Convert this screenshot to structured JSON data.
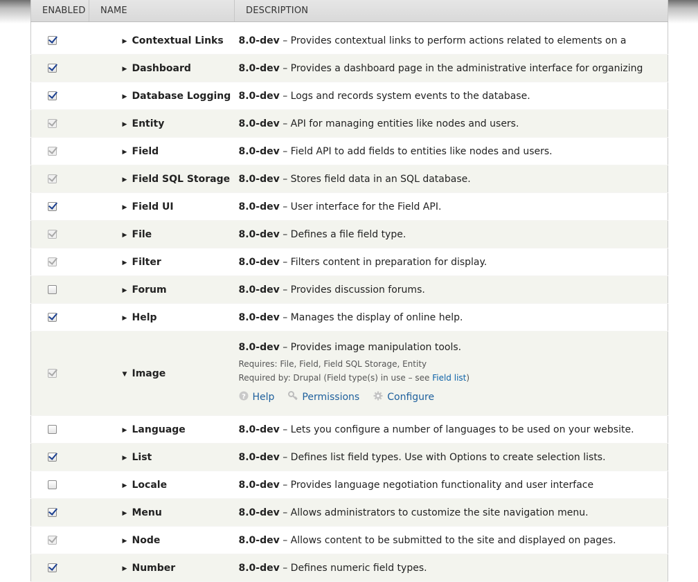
{
  "header": {
    "enabled": "ENABLED",
    "name": "NAME",
    "description": "DESCRIPTION"
  },
  "modules": [
    {
      "name": "Contextual Links",
      "version": "8.0-dev",
      "description": "– Provides contextual links to perform actions related to elements on a",
      "checked": true,
      "disabled": false
    },
    {
      "name": "Dashboard",
      "version": "8.0-dev",
      "description": "– Provides a dashboard page in the administrative interface for organizing",
      "checked": true,
      "disabled": false
    },
    {
      "name": "Database Logging",
      "version": "8.0-dev",
      "description": "– Logs and records system events to the database.",
      "checked": true,
      "disabled": false
    },
    {
      "name": "Entity",
      "version": "8.0-dev",
      "description": "– API for managing entities like nodes and users.",
      "checked": true,
      "disabled": true
    },
    {
      "name": "Field",
      "version": "8.0-dev",
      "description": "– Field API to add fields to entities like nodes and users.",
      "checked": true,
      "disabled": true
    },
    {
      "name": "Field SQL Storage",
      "version": "8.0-dev",
      "description": "– Stores field data in an SQL database.",
      "checked": true,
      "disabled": true
    },
    {
      "name": "Field UI",
      "version": "8.0-dev",
      "description": "– User interface for the Field API.",
      "checked": true,
      "disabled": false
    },
    {
      "name": "File",
      "version": "8.0-dev",
      "description": "– Defines a file field type.",
      "checked": true,
      "disabled": true
    },
    {
      "name": "Filter",
      "version": "8.0-dev",
      "description": "– Filters content in preparation for display.",
      "checked": true,
      "disabled": true
    },
    {
      "name": "Forum",
      "version": "8.0-dev",
      "description": "– Provides discussion forums.",
      "checked": false,
      "disabled": false
    },
    {
      "name": "Help",
      "version": "8.0-dev",
      "description": "– Manages the display of online help.",
      "checked": true,
      "disabled": false
    },
    {
      "name": "Image",
      "version": "8.0-dev",
      "description": "– Provides image manipulation tools.",
      "checked": true,
      "disabled": true,
      "expanded": true,
      "requires": "Requires: File, Field, Field SQL Storage, Entity",
      "required_by_prefix": "Required by: Drupal (Field type(s) in use – see ",
      "required_by_link": "Field list",
      "required_by_suffix": ")",
      "links": {
        "help": "Help",
        "permissions": "Permissions",
        "configure": "Configure"
      }
    },
    {
      "name": "Language",
      "version": "8.0-dev",
      "description": "– Lets you configure a number of languages to be used on your website.",
      "checked": false,
      "disabled": false
    },
    {
      "name": "List",
      "version": "8.0-dev",
      "description": "– Defines list field types. Use with Options to create selection lists.",
      "checked": true,
      "disabled": false
    },
    {
      "name": "Locale",
      "version": "8.0-dev",
      "description": "– Provides language negotiation functionality and user interface",
      "checked": false,
      "disabled": false
    },
    {
      "name": "Menu",
      "version": "8.0-dev",
      "description": "– Allows administrators to customize the site navigation menu.",
      "checked": true,
      "disabled": false
    },
    {
      "name": "Node",
      "version": "8.0-dev",
      "description": "– Allows content to be submitted to the site and displayed on pages.",
      "checked": true,
      "disabled": true
    },
    {
      "name": "Number",
      "version": "8.0-dev",
      "description": "– Defines numeric field types.",
      "checked": true,
      "disabled": false
    }
  ]
}
